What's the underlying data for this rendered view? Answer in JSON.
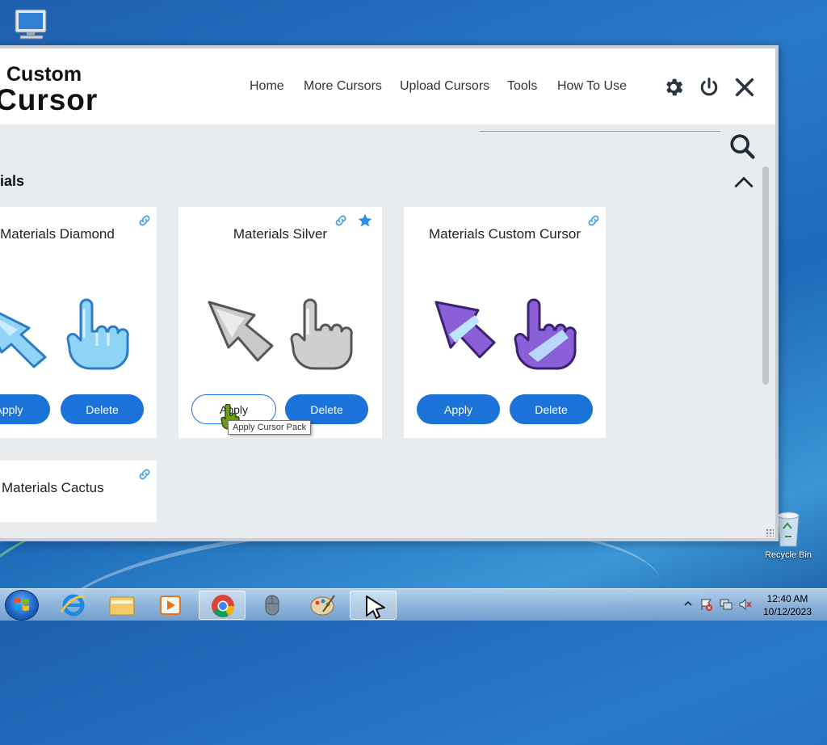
{
  "desktop": {
    "icons": [
      {
        "name": "computer",
        "label": ""
      },
      {
        "name": "recycle-bin",
        "label": "Recycle Bin"
      }
    ]
  },
  "app": {
    "logo": {
      "line1": "Custom",
      "line2": "Cursor"
    },
    "nav": [
      "Home",
      "More Cursors",
      "Upload Cursors",
      "Tools",
      "How To Use"
    ],
    "header_icons": [
      "gear-icon",
      "power-icon",
      "close-icon"
    ],
    "search": {
      "placeholder": ""
    },
    "section": {
      "title": "ials"
    },
    "cards": [
      {
        "title": "Materials Diamond",
        "apply_label": "Apply",
        "delete_label": "Delete",
        "favorite": false,
        "color": "#5bb8ef"
      },
      {
        "title": "Materials Silver",
        "apply_label": "Apply",
        "delete_label": "Delete",
        "favorite": true,
        "color": "#b8b8b8"
      },
      {
        "title": "Materials Custom Cursor",
        "apply_label": "Apply",
        "delete_label": "Delete",
        "favorite": false,
        "color": "#8a5fd8"
      },
      {
        "title": "Materials Cactus",
        "favorite": false
      }
    ],
    "tooltip": "Apply Cursor Pack"
  },
  "taskbar": {
    "apps": [
      "start",
      "internet-explorer",
      "file-explorer",
      "media-player",
      "chrome",
      "mouse",
      "paint",
      "custom-cursor"
    ],
    "clock": {
      "time": "12:40 AM",
      "date": "10/12/2023"
    }
  },
  "colors": {
    "accent": "#1b72d9",
    "link": "#4aa3e0",
    "star": "#2b8ee6"
  }
}
